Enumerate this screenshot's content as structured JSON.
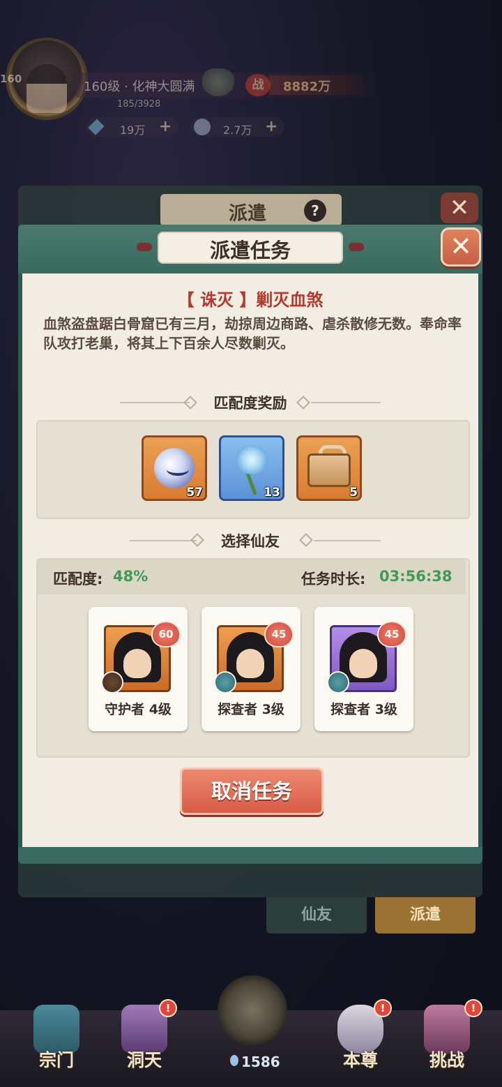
{
  "hud": {
    "player_level_badge": "160",
    "level_title": "160级 · 化神大圆满",
    "exp": "185/3928",
    "power_label": "战",
    "power": "8882万",
    "gems": "19万",
    "coins": "2.7万",
    "plus": "+"
  },
  "back_panel": {
    "title": "派遣",
    "help": "?",
    "close": "✕",
    "tabs": [
      "仙友",
      "派遣"
    ]
  },
  "dialog": {
    "title": "派遣任务",
    "close": "✕",
    "mission_title": "【 诛灭 】剿灭血煞",
    "mission_desc": "血煞盗盘踞白骨窟已有三月，劫掠周边商路、虐杀散修无数。奉命率队攻打老巢，将其上下百余人尽数剿灭。",
    "rewards_heading": "匹配度奖励",
    "rewards": [
      {
        "icon": "spirit-orb-icon",
        "count": "57",
        "rarity": "orange"
      },
      {
        "icon": "blue-rose-icon",
        "count": "13",
        "rarity": "blue"
      },
      {
        "icon": "treasure-chest-icon",
        "count": "5",
        "rarity": "orange"
      }
    ],
    "select_heading": "选择仙友",
    "match_label": "匹配度:",
    "match_value": "48%",
    "duration_label": "任务时长:",
    "duration_value": "03:56:38",
    "heroes": [
      {
        "level": "60",
        "role": "守护者 4级",
        "role_icon": "shield-icon",
        "frame": "orange"
      },
      {
        "level": "45",
        "role": "探查者 3级",
        "role_icon": "compass-icon",
        "frame": "orange"
      },
      {
        "level": "45",
        "role": "探查者 3级",
        "role_icon": "compass-icon",
        "frame": "purple"
      }
    ],
    "cancel_button": "取消任务"
  },
  "nav": {
    "items": [
      {
        "label": "宗门",
        "badge": ""
      },
      {
        "label": "洞天",
        "badge": "!"
      },
      {
        "label": "本尊",
        "badge": "!"
      },
      {
        "label": "挑战",
        "badge": "!"
      }
    ],
    "center_value": "1586"
  },
  "colors": {
    "accent_red": "#b23a2e",
    "match_green": "#3f9a55",
    "dialog_teal": "#2f5a52",
    "panel_cream": "#f1ede2",
    "cancel_orange": "#d45a46"
  }
}
